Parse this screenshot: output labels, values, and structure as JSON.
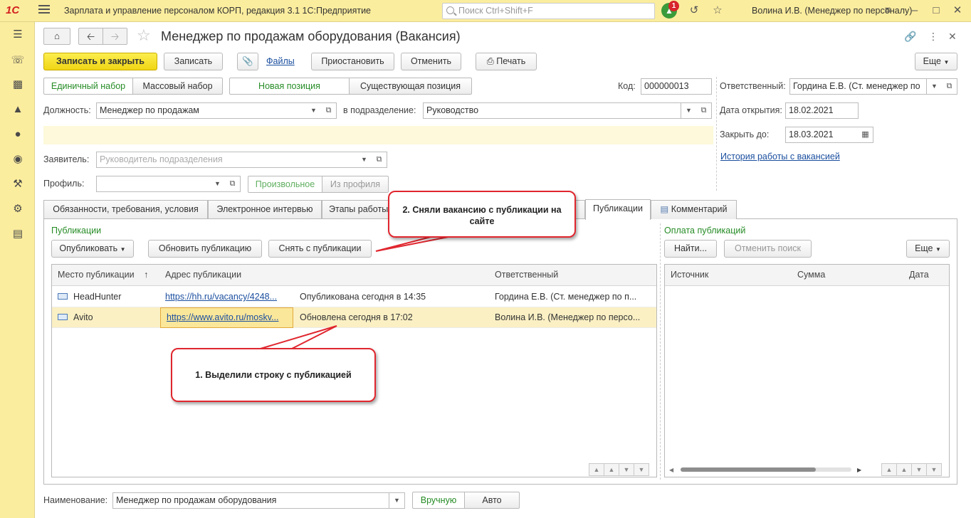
{
  "topbar": {
    "logo": "1С",
    "app_title": "Зарплата и управление персоналом КОРП, редакция 3.1 1С:Предприятие",
    "search_placeholder": "Поиск Ctrl+Shift+F",
    "notification_count": "1",
    "user": "Волина И.В. (Менеджер по персоналу)"
  },
  "form": {
    "title": "Менеджер по продажам оборудования (Вакансия)",
    "buttons": {
      "save_close": "Записать и закрыть",
      "save": "Записать",
      "files": "Файлы",
      "pause": "Приостановить",
      "cancel": "Отменить",
      "print": "Печать",
      "more": "Еще"
    },
    "set_type": {
      "single": "Единичный набор",
      "mass": "Массовый набор"
    },
    "position_type": {
      "new": "Новая позиция",
      "existing": "Существующая позиция"
    },
    "code_label": "Код:",
    "code_value": "000000013",
    "responsible_label": "Ответственный:",
    "responsible_value": "Гордина Е.В. (Ст. менеджер по",
    "position_label": "Должность:",
    "position_value": "Менеджер по продажам",
    "department_label": "в подразделение:",
    "department_value": "Руководство",
    "open_date_label": "Дата открытия:",
    "open_date_value": "18.02.2021",
    "close_by_label": "Закрыть до:",
    "close_by_value": "18.03.2021",
    "history_link": "История работы с вакансией",
    "applicant_label": "Заявитель:",
    "applicant_placeholder": "Руководитель подразделения",
    "profile_label": "Профиль:",
    "profile_value": "",
    "profile_mode": {
      "custom": "Произвольное",
      "from_profile": "Из профиля"
    },
    "name_label": "Наименование:",
    "name_value": "Менеджер по продажам оборудования",
    "name_mode": {
      "manual": "Вручную",
      "auto": "Авто"
    }
  },
  "tabs": [
    {
      "label": "Обязанности, требования, условия"
    },
    {
      "label": "Электронное интервью"
    },
    {
      "label": "Этапы работы"
    },
    {
      "label": "Публикации"
    },
    {
      "label": "Комментарий"
    }
  ],
  "publications": {
    "section_title": "Публикации",
    "publish_button": "Опубликовать",
    "update_button": "Обновить публикацию",
    "unpublish_button": "Снять с публикации",
    "columns": [
      "Место публикации",
      "Адрес публикации",
      "",
      "Ответственный"
    ],
    "rows": [
      {
        "place": "HeadHunter",
        "address": "https://hh.ru/vacancy/4248...",
        "status": "Опубликована сегодня в 14:35",
        "responsible": "Гордина Е.В. (Ст. менеджер по п..."
      },
      {
        "place": "Avito",
        "address": "https://www.avito.ru/moskv...",
        "status": "Обновлена сегодня в 17:02",
        "responsible": "Волина И.В. (Менеджер по персо..."
      }
    ]
  },
  "payments": {
    "section_title": "Оплата публикаций",
    "find_button": "Найти...",
    "cancel_search_button": "Отменить поиск",
    "more_button": "Еще",
    "columns": [
      "Источник",
      "Сумма",
      "Дата"
    ]
  },
  "callouts": {
    "step1": "1. Выделили строку с публикацией",
    "step2": "2. Сняли вакансию с публикации на сайте"
  }
}
